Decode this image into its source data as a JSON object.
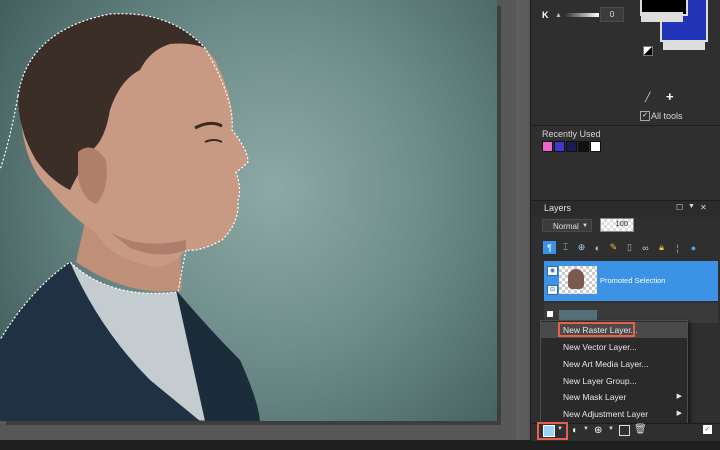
{
  "color_panel": {
    "k_label": "K",
    "k_value": "0"
  },
  "materials": {
    "all_tools_label": "All tools",
    "recently_used_label": "Recently Used",
    "recent_colors": [
      "#ee66cc",
      "#3a3acc",
      "#1b1b55",
      "#111111",
      "#ffffff"
    ],
    "foreground_color": "#000000",
    "background_color": "#2235b8"
  },
  "layers": {
    "title": "Layers",
    "blend_mode": "Normal",
    "opacity": "100",
    "items": [
      {
        "name": "Promoted Selection"
      }
    ],
    "selected_color": "#3c92e5"
  },
  "context_menu": {
    "items": [
      {
        "label": "New Raster Layer...",
        "submenu": false,
        "highlighted": true
      },
      {
        "label": "New Vector Layer...",
        "submenu": false,
        "highlighted": false
      },
      {
        "label": "New Art Media Layer...",
        "submenu": false,
        "highlighted": false
      },
      {
        "label": "New Layer Group...",
        "submenu": false,
        "highlighted": false
      },
      {
        "label": "New Mask Layer",
        "submenu": true,
        "highlighted": false
      },
      {
        "label": "New Adjustment Layer",
        "submenu": true,
        "highlighted": false
      }
    ],
    "highlight_outline_color": "#e8604c"
  }
}
